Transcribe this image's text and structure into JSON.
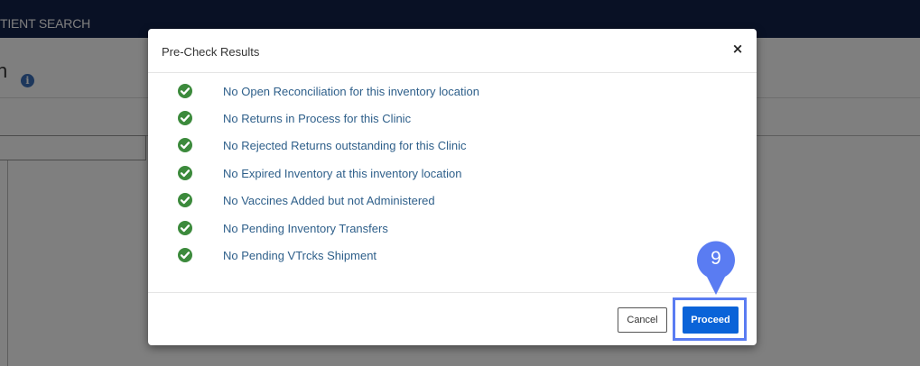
{
  "app": {
    "topbar_title": "TIENT SEARCH",
    "page_heading": "n",
    "info_icon": "info-icon"
  },
  "modal": {
    "title": "Pre-Check Results",
    "close_label": "×",
    "checks": [
      {
        "text": "No Open Reconciliation for this inventory location",
        "status": "passed",
        "icon": "check-circle-icon"
      },
      {
        "text": "No Returns in Process for this Clinic",
        "status": "passed",
        "icon": "check-circle-icon"
      },
      {
        "text": "No Rejected Returns outstanding for this Clinic",
        "status": "passed",
        "icon": "check-circle-icon"
      },
      {
        "text": "No Expired Inventory at this inventory location",
        "status": "passed",
        "icon": "check-circle-icon"
      },
      {
        "text": "No Vaccines Added but not Administered",
        "status": "passed",
        "icon": "check-circle-icon"
      },
      {
        "text": "No Pending Inventory Transfers",
        "status": "passed",
        "icon": "check-circle-icon"
      },
      {
        "text": "No Pending VTrcks Shipment",
        "status": "passed",
        "icon": "check-circle-icon"
      }
    ],
    "cancel_label": "Cancel",
    "proceed_label": "Proceed"
  },
  "step_marker": {
    "number": "9",
    "icon": "map-pin-icon"
  },
  "colors": {
    "topbar": "#13224a",
    "check_green": "#3c8a3c",
    "check_text": "#2e5f8a",
    "proceed_blue": "#0a63d8",
    "highlight": "#5a7cf2",
    "marker": "#5a7cf2"
  }
}
